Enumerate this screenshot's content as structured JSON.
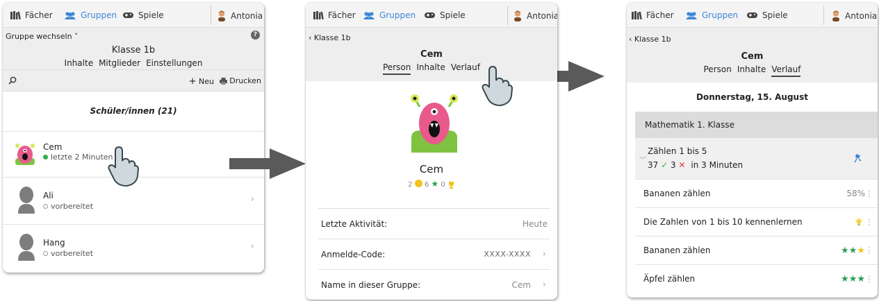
{
  "nav": {
    "subjects": "Fächer",
    "groups": "Gruppen",
    "games": "Spiele",
    "user": "Antonia"
  },
  "colors": {
    "accent": "#3c87d6",
    "online": "#2fb04a",
    "star": "#2e9d54",
    "coin": "#f2c21b",
    "wrong": "#e23b3b"
  },
  "panel1": {
    "switch_group": "Gruppe wechseln ˅",
    "help_icon": "?",
    "class_name": "Klasse 1b",
    "tabs": [
      "Inhalte",
      "Mitglieder",
      "Einstellungen"
    ],
    "new_label": "Neu",
    "print_label": "Drucken",
    "section_title": "Schüler/innen (21)",
    "students": [
      {
        "name": "Cem",
        "status": "letzte 2 Minuten",
        "online": true
      },
      {
        "name": "Ali",
        "status": "vorbereitet",
        "online": false
      },
      {
        "name": "Hang",
        "status": "vorbereitet",
        "online": false
      }
    ]
  },
  "panel2": {
    "back": "‹ Klasse 1b",
    "student_name": "Cem",
    "tabs": [
      "Person",
      "Inhalte",
      "Verlauf"
    ],
    "profile_name": "Cem",
    "coins": "2",
    "stars": "6",
    "trophies": "0",
    "details": [
      {
        "label": "Letzte Aktivität:",
        "value": "Heute",
        "chevron": false
      },
      {
        "label": "Anmelde-Code:",
        "value": "XXXX-XXXX",
        "chevron": true
      },
      {
        "label": "Name in dieser Gruppe:",
        "value": "Cem",
        "chevron": true
      }
    ]
  },
  "panel3": {
    "back": "‹ Klasse 1b",
    "student_name": "Cem",
    "tabs": [
      "Person",
      "Inhalte",
      "Verlauf"
    ],
    "date": "Donnerstag, 15. August",
    "course": "Mathematik 1. Klasse",
    "unit_title": "Zählen 1 bis 5",
    "unit_correct": "37",
    "unit_wrong": "3",
    "unit_time": "in 3 Minuten",
    "items": [
      {
        "title": "Bananen zählen",
        "result": "58%"
      },
      {
        "title": "Die Zahlen von 1 bis 10 kennenlernen",
        "result": ""
      },
      {
        "title": "Bananen zählen",
        "result": ""
      },
      {
        "title": "Äpfel zählen",
        "result": ""
      }
    ]
  }
}
